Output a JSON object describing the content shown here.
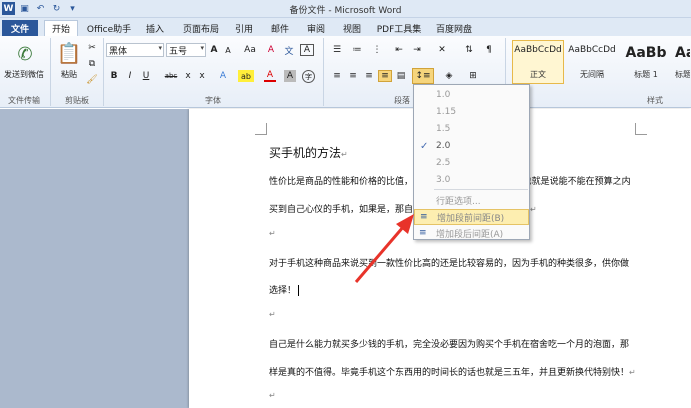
{
  "window": {
    "title": "备份文件 - Microsoft Word"
  },
  "tabs": [
    "文件",
    "开始",
    "Office助手",
    "插入",
    "页面布局",
    "引用",
    "邮件",
    "审阅",
    "视图",
    "PDF工具集",
    "百度网盘"
  ],
  "ribbon": {
    "send_wechat": "发送到微信",
    "paste": "粘贴",
    "groups": {
      "transfer": "文件传输",
      "clipboard": "剪贴板",
      "font": "字体",
      "paragraph": "段落",
      "styles": "样式"
    },
    "font_name": "黑体",
    "font_size": "五号",
    "font_buttons": {
      "grow": "A",
      "shrink": "A",
      "case": "Aa",
      "clear": "A",
      "phonetic": "文",
      "border_char": "A"
    },
    "format_buttons": {
      "bold": "B",
      "italic": "I",
      "underline": "U",
      "strike": "abc",
      "subscript": "x",
      "superscript": "x",
      "effects": "A",
      "highlight": "ab",
      "color": "A",
      "shade": "A",
      "enclose": "字"
    },
    "styles": [
      {
        "preview": "AaBbCcDd",
        "name": "正文"
      },
      {
        "preview": "AaBbCcDd",
        "name": "无间隔"
      },
      {
        "preview": "AaBb",
        "name": "标题 1"
      },
      {
        "preview": "AaBl",
        "name": "标题"
      }
    ]
  },
  "menu": {
    "spacing_values": [
      "1.0",
      "1.15",
      "1.5",
      "2.0",
      "2.5",
      "3.0"
    ],
    "checked_index": 3,
    "options_label": "行距选项...",
    "add_before": "增加段前间距(B)",
    "add_after": "增加段后间距(A)"
  },
  "document": {
    "title": "买手机的方法",
    "lines": [
      "性价比是商品的性能和价格的比值，公式是性价比=性能/价格，也就是说能不能在预算之内",
      "买到自己心仪的手机，如果是，那自然是性价比高，反之则不是。",
      "",
      "对于手机这种商品来说买到一款性价比高的还是比较容易的，因为手机的种类很多，供你做",
      "选择！",
      "",
      "自己是什么能力就买多少钱的手机，完全没必要因为购买个手机在宿舍吃一个月的泡面，那",
      "样是真的不值得。毕竟手机这个东西用的时间长的话也就是三五年，并且更新换代特别快！",
      ""
    ],
    "paragraph_mark": "↵"
  }
}
